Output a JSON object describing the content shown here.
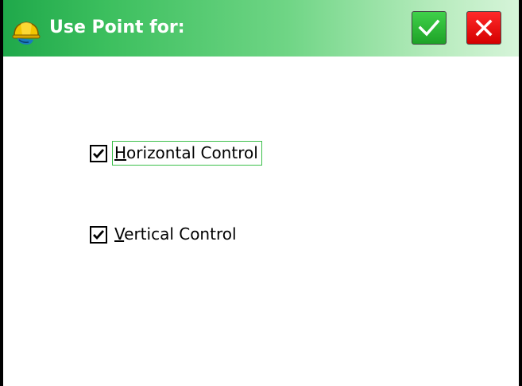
{
  "window": {
    "title": "Use Point for:"
  },
  "titlebar": {
    "app_icon": "hardhat-icon",
    "ok_icon": "checkmark-icon",
    "close_icon": "close-x-icon",
    "colors": {
      "gradient_start": "#1fa84a",
      "gradient_end": "#d6f4d9",
      "ok_button": "#2bbf33",
      "close_button": "#ee0000"
    }
  },
  "options": [
    {
      "mnemonic": "H",
      "rest": "orizontal Control",
      "checked": true,
      "focused": true
    },
    {
      "mnemonic": "V",
      "rest": "ertical Control",
      "checked": true,
      "focused": false
    }
  ]
}
